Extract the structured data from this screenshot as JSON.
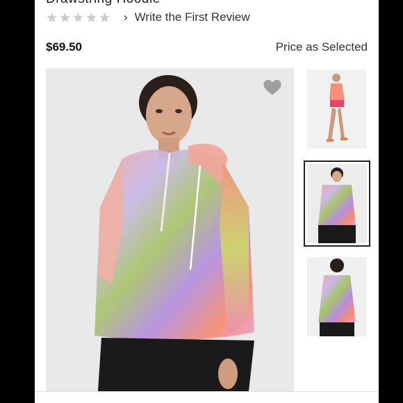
{
  "product": {
    "title": "Drawstring Hoodie",
    "rating": 0,
    "rating_max": 5,
    "review_link": "Write the First Review",
    "price": "$69.50",
    "price_note": "Price as Selected"
  },
  "icons": {
    "star": "star-icon",
    "chevron": "chevron-right-icon",
    "heart": "heart-icon"
  },
  "colors": {
    "star_empty": "#cccccc",
    "heart": "#9e9e9e",
    "image_bg": "#e9e9e9"
  },
  "gallery": {
    "selected_index": 1,
    "thumbnails": [
      "front-walking",
      "front-hoodie",
      "back-hoodie"
    ]
  }
}
